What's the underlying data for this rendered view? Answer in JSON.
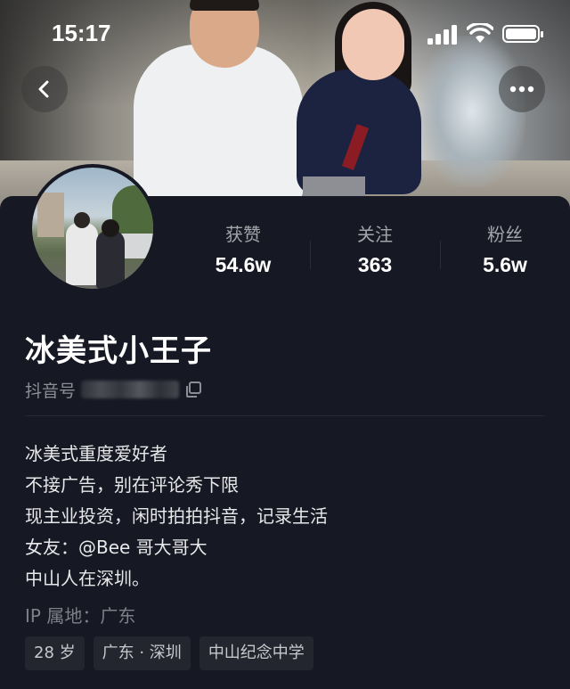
{
  "status_bar": {
    "time": "15:17"
  },
  "nav": {
    "back_icon": "chevron-left-icon",
    "more_icon": "ellipsis-icon"
  },
  "profile": {
    "name": "冰美式小王子",
    "douyin_id_label": "抖音号"
  },
  "stats": [
    {
      "label": "获赞",
      "value": "54.6w"
    },
    {
      "label": "关注",
      "value": "363"
    },
    {
      "label": "粉丝",
      "value": "5.6w"
    }
  ],
  "bio": [
    "冰美式重度爱好者",
    "不接广告，别在评论秀下限",
    "现主业投资，闲时拍拍抖音，记录生活",
    "女友：@Bee 哥大哥大",
    "中山人在深圳。"
  ],
  "ip_location": "IP 属地：广东",
  "tags": [
    "28 岁",
    "广东 · 深圳",
    "中山纪念中学"
  ],
  "colors": {
    "background": "#161823",
    "muted_text": "#8c8e95",
    "tag_bg": "#24262f"
  }
}
